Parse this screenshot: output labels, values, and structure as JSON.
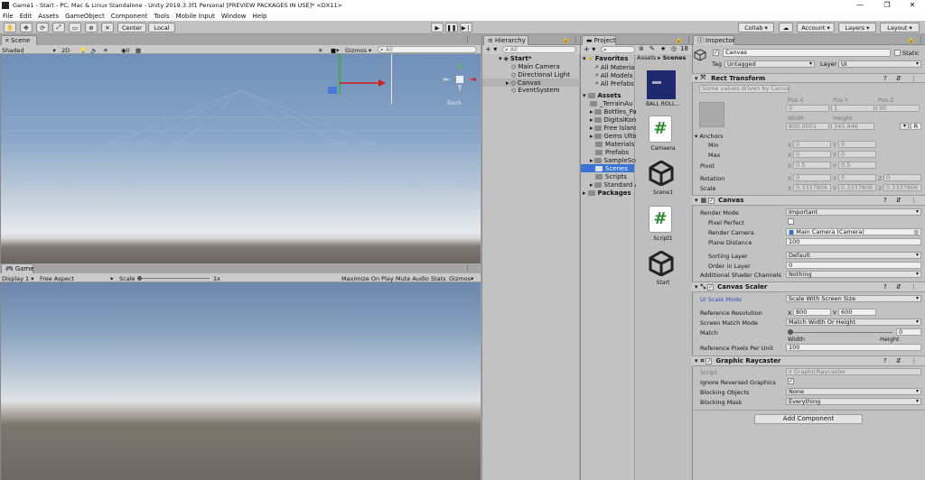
{
  "window": {
    "title": "Game1 - Start - PC, Mac & Linux Standalone - Unity 2019.3.3f1 Personal [PREVIEW PACKAGES IN USE]* <DX11>"
  },
  "menu": [
    "File",
    "Edit",
    "Assets",
    "GameObject",
    "Component",
    "Tools",
    "Mobile Input",
    "Window",
    "Help"
  ],
  "toolbar": {
    "center": "Center",
    "local": "Local",
    "collab": "Collab",
    "account": "Account",
    "layers": "Layers",
    "layout": "Layout"
  },
  "scene": {
    "tab": "Scene",
    "shading": "Shaded",
    "mode2d": "2D",
    "gizmos": "Gizmos",
    "search_placeholder": "All",
    "fx_count": "0",
    "back_label": "Back"
  },
  "game": {
    "tab": "Game",
    "display": "Display 1",
    "aspect": "Free Aspect",
    "scale_label": "Scale",
    "scale_value": "1x",
    "maximize": "Maximize On Play",
    "mute": "Mute Audio",
    "stats": "Stats",
    "gizmos": "Gizmos"
  },
  "hierarchy": {
    "tab": "Hierarchy",
    "search_placeholder": "All",
    "scene": "Start*",
    "items": [
      "Main Camera",
      "Directional Light",
      "Canvas",
      "EventSystem"
    ]
  },
  "project": {
    "tab": "Project",
    "count": "18",
    "favorites_label": "Favorites",
    "favorites": [
      "All Materia",
      "All Models",
      "All Prefabs"
    ],
    "assets_label": "Assets",
    "assets": [
      "_TerrainAu",
      "Bottles_Pa",
      "DigitalKon",
      "Free Island",
      "Gems Ultim",
      "Materials",
      "Prefabs",
      "SampleSce",
      "Scenes",
      "Scripts",
      "Standard A"
    ],
    "packages_label": "Packages",
    "breadcrumb": [
      "Assets",
      "Scenes"
    ],
    "files": [
      "BALL ROLL...",
      "Camaera",
      "Scene1",
      "Script1",
      "Start"
    ]
  },
  "inspector": {
    "tab": "Inspector",
    "name": "Canvas",
    "static": "Static",
    "tag_label": "Tag",
    "tag": "Untagged",
    "layer_label": "Layer",
    "layer": "UI",
    "rect": {
      "title": "Rect Transform",
      "note": "Some values driven by Canvas.",
      "posx_label": "Pos X",
      "posy_label": "Pos Y",
      "posz_label": "Pos Z",
      "posx": "0",
      "posy": "1",
      "posz": "90",
      "width_label": "Width",
      "height_label": "Height",
      "width": "800.0001",
      "height": "345.946",
      "r": "R",
      "anchors": "Anchors",
      "min": "Min",
      "max": "Max",
      "min_x": "0",
      "min_y": "0",
      "max_x": "0",
      "max_y": "0",
      "pivot": "Pivot",
      "pivot_x": "0.5",
      "pivot_y": "0.5",
      "rotation": "Rotation",
      "rot_x": "0",
      "rot_y": "0",
      "rot_z": "0",
      "scale": "Scale",
      "scale_x": "0.3337806",
      "scale_y": "0.3337806",
      "scale_z": "0.3337806",
      "x": "X",
      "y": "Y",
      "z": "Z"
    },
    "canvas": {
      "title": "Canvas",
      "render_mode_label": "Render Mode",
      "render_mode": "Important",
      "pixel_perfect": "Pixel Perfect",
      "render_camera_label": "Render Camera",
      "render_camera": "Main Camera (Camera)",
      "plane_distance_label": "Plane Distance",
      "plane_distance": "100",
      "sorting_layer_label": "Sorting Layer",
      "sorting_layer": "Default",
      "order_label": "Order in Layer",
      "order": "0",
      "shader_label": "Additional Shader Channels",
      "shader": "Nothing"
    },
    "scaler": {
      "title": "Canvas Scaler",
      "mode_label": "UI Scale Mode",
      "mode": "Scale With Screen Size",
      "ref_res_label": "Reference Resolution",
      "ref_x": "800",
      "ref_y": "600",
      "match_mode_label": "Screen Match Mode",
      "match_mode": "Match Width Or Height",
      "match_label": "Match",
      "match_value": "0",
      "match_fraction": 0,
      "width": "Width",
      "height": "Height",
      "ppu_label": "Reference Pixels Per Unit",
      "ppu": "100"
    },
    "raycaster": {
      "title": "Graphic Raycaster",
      "script_label": "Script",
      "script": "GraphicRaycaster",
      "ignore_label": "Ignore Reversed Graphics",
      "blocking_label": "Blocking Objects",
      "blocking": "None",
      "mask_label": "Blocking Mask",
      "mask": "Everything"
    },
    "add_component": "Add Component"
  }
}
